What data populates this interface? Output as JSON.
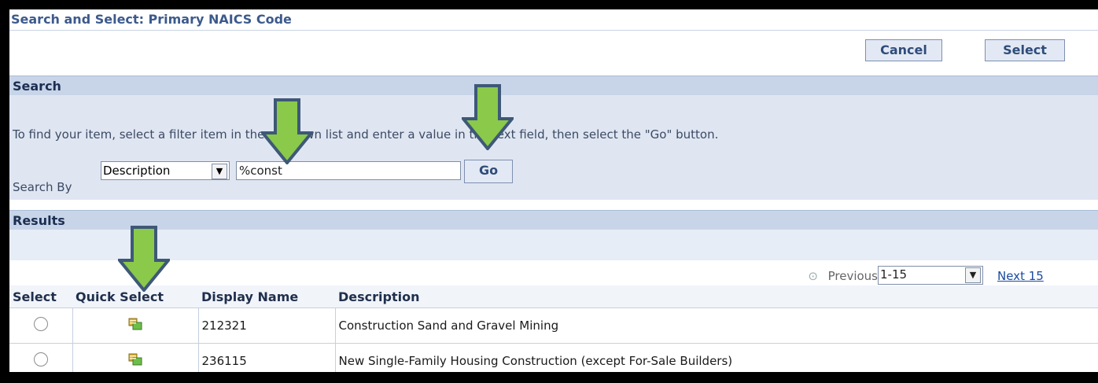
{
  "dialog": {
    "title": "Search and Select: Primary NAICS Code"
  },
  "buttons": {
    "cancel": "Cancel",
    "select": "Select"
  },
  "search": {
    "heading": "Search",
    "instructions": "To find your item, select a filter item in the pulldown list and enter a value in the text field, then select the \"Go\" button.",
    "search_by_label": "Search By",
    "filter_selected": "Description",
    "filter_value": "%const",
    "go_label": "Go"
  },
  "results": {
    "heading": "Results",
    "pager": {
      "previous": "Previous",
      "range": "1-15",
      "next": "Next 15"
    },
    "columns": [
      "Select",
      "Quick Select",
      "Display Name",
      "Description"
    ],
    "rows": [
      {
        "display_name": "212321",
        "description": "Construction Sand and Gravel Mining"
      },
      {
        "display_name": "236115",
        "description": "New Single-Family Housing Construction (except For-Sale Builders)"
      }
    ]
  },
  "colors": {
    "accent_arrow": "#8ac94a",
    "arrow_outline": "#3e5877"
  }
}
